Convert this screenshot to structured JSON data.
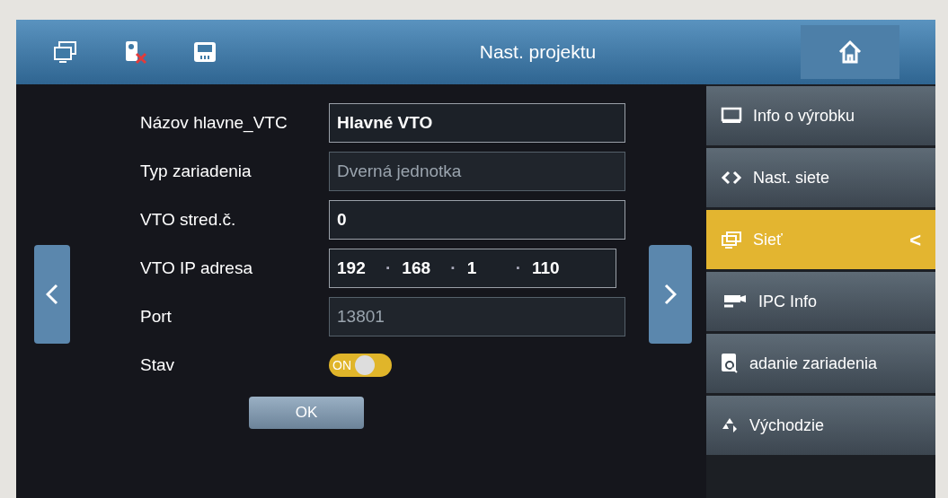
{
  "header": {
    "title": "Nast. projektu"
  },
  "form": {
    "fields": [
      {
        "kind": "text",
        "label": "Názov hlavne_VTC",
        "value": "Hlavné VTO",
        "disabled": false
      },
      {
        "kind": "text",
        "label": "Typ zariadenia",
        "value": "Dverná jednotka",
        "disabled": true
      },
      {
        "kind": "text",
        "label": "VTO stred.č.",
        "value": "0",
        "disabled": false
      },
      {
        "kind": "ip",
        "label": "VTO IP adresa",
        "parts": [
          "192",
          "168",
          "1",
          "110"
        ],
        "separator": "·",
        "disabled": false
      },
      {
        "kind": "text",
        "label": "Port",
        "value": "13801",
        "disabled": true
      },
      {
        "kind": "toggle",
        "label": "Stav",
        "value": "ON",
        "on": true
      }
    ],
    "ok_button": "OK"
  },
  "sidebar": {
    "items": [
      {
        "label": "Info o výrobku",
        "selected": false
      },
      {
        "label": "Nast. siete",
        "selected": false
      },
      {
        "label": "Sieť",
        "selected": true,
        "indicator": "<"
      },
      {
        "label": "IPC Info",
        "selected": false
      },
      {
        "label": "adanie zariadenia",
        "selected": false
      },
      {
        "label": "Východzie",
        "selected": false
      }
    ]
  }
}
